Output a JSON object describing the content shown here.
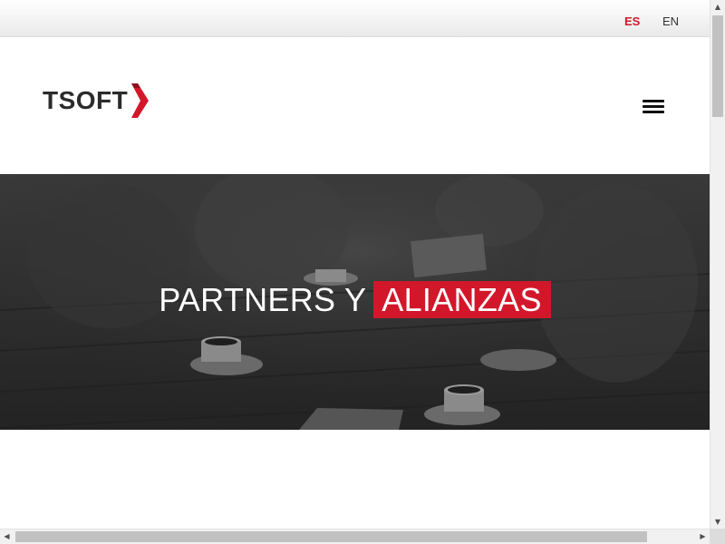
{
  "languages": {
    "es_label": "ES",
    "en_label": "EN",
    "active": "ES"
  },
  "header": {
    "logo_text": "TSOFT",
    "menu_icon": "hamburger-menu-icon"
  },
  "hero": {
    "title_plain": "PARTNERS Y",
    "title_highlight": "ALIANZAS"
  },
  "colors": {
    "brand_red": "#d2172a",
    "logo_dark": "#2b2b2b",
    "hero_overlay": "#2a2a2a"
  },
  "scrollbars": {
    "up_arrow": "▲",
    "down_arrow": "▼",
    "left_arrow": "◀",
    "right_arrow": "▶"
  }
}
